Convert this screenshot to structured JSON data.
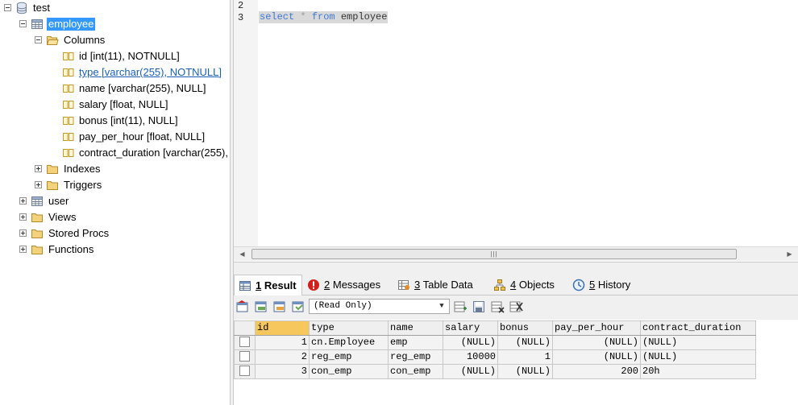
{
  "tree": {
    "database": "test",
    "tables": [
      "employee",
      "user"
    ],
    "selected_table": "employee",
    "folders": {
      "columns": "Columns",
      "indexes": "Indexes",
      "triggers": "Triggers"
    },
    "columns": [
      "id [int(11), NOTNULL]",
      "type [varchar(255), NOTNULL]",
      "name [varchar(255), NULL]",
      "salary [float, NULL]",
      "bonus [int(11), NULL]",
      "pay_per_hour [float, NULL]",
      "contract_duration [varchar(255),"
    ],
    "other_folders": [
      "Views",
      "Stored Procs",
      "Functions"
    ]
  },
  "editor": {
    "line_numbers": [
      "2",
      "3"
    ],
    "query": {
      "kw1": "select",
      "op": "*",
      "kw2": "from",
      "table": "employee"
    }
  },
  "tabs": [
    {
      "num": "1",
      "label": "Result",
      "active": true
    },
    {
      "num": "2",
      "label": "Messages"
    },
    {
      "num": "3",
      "label": "Table Data"
    },
    {
      "num": "4",
      "label": "Objects"
    },
    {
      "num": "5",
      "label": "History"
    }
  ],
  "result_toolbar": {
    "mode": "(Read Only)"
  },
  "result": {
    "columns": [
      "id",
      "type",
      "name",
      "salary",
      "bonus",
      "pay_per_hour",
      "contract_duration"
    ],
    "rows": [
      [
        "1",
        "cn.Employee",
        "emp",
        "(NULL)",
        "(NULL)",
        "(NULL)",
        "(NULL)"
      ],
      [
        "2",
        "reg_emp",
        "reg_emp",
        "10000",
        "1",
        "(NULL)",
        "(NULL)"
      ],
      [
        "3",
        "con_emp",
        "con_emp",
        "(NULL)",
        "(NULL)",
        "200",
        "20h"
      ]
    ]
  },
  "colors": {
    "selection": "#3399ff",
    "keyword": "#3e78d6",
    "header_highlight": "#f6c75c",
    "link": "#1a5fb4"
  }
}
